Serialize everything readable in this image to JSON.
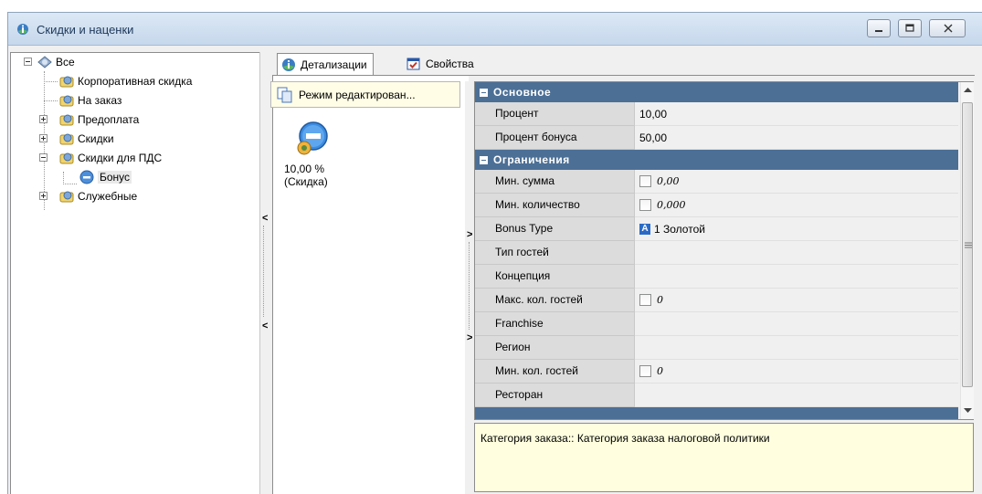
{
  "window": {
    "title": "Скидки и наценки",
    "controls": [
      "minimize",
      "maximize",
      "close"
    ]
  },
  "tree": {
    "root": "Все",
    "items": [
      {
        "label": "Корпоративная скидка",
        "expandable": false
      },
      {
        "label": "На заказ",
        "expandable": false
      },
      {
        "label": "Предоплата",
        "expandable": true
      },
      {
        "label": "Скидки",
        "expandable": true
      },
      {
        "label": "Скидки для ПДС",
        "expandable": true,
        "expanded": true,
        "children": [
          {
            "label": "Бонус",
            "selected": true
          }
        ]
      },
      {
        "label": "Служебные",
        "expandable": true
      }
    ]
  },
  "tabs": [
    {
      "label": "Детализации",
      "active": true,
      "icon": "info-icon"
    },
    {
      "label": "Свойства",
      "active": false,
      "icon": "properties-icon"
    }
  ],
  "middle": {
    "mode_label": "Режим редактирован...",
    "item_value": "10,00 %",
    "item_type": "(Скидка)"
  },
  "grid": {
    "categories": [
      {
        "label": "Основное",
        "rows": [
          {
            "name": "Процент",
            "value": "10,00"
          },
          {
            "name": "Процент бонуса",
            "value": "50,00"
          }
        ]
      },
      {
        "label": "Ограничения",
        "rows": [
          {
            "name": "Мин. сумма",
            "checkbox": true,
            "value": "0,00"
          },
          {
            "name": "Мин. количество",
            "checkbox": true,
            "value": "0,000"
          },
          {
            "name": "Bonus Type",
            "badge": "A",
            "value": "1 Золотой"
          },
          {
            "name": "Тип гостей",
            "value": ""
          },
          {
            "name": "Концепция",
            "value": ""
          },
          {
            "name": "Макс. кол. гостей",
            "checkbox": true,
            "value": "0"
          },
          {
            "name": "Franchise",
            "value": ""
          },
          {
            "name": "Регион",
            "value": ""
          },
          {
            "name": "Мин. кол. гостей",
            "checkbox": true,
            "value": "0"
          },
          {
            "name": "Ресторан",
            "value": ""
          }
        ]
      }
    ]
  },
  "description": "Категория заказа:: Категория заказа налоговой политики",
  "colors": {
    "category_header": "#4c6f96",
    "description_bg": "#ffffdf",
    "mode_bg": "#fffde6"
  }
}
